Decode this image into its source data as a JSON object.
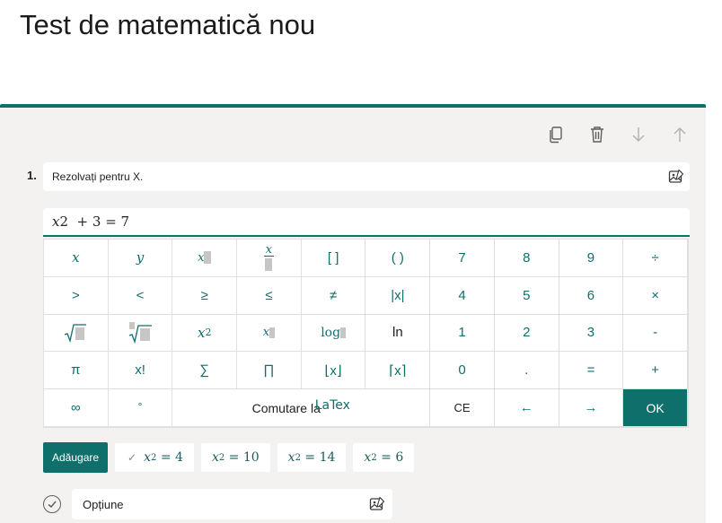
{
  "page": {
    "title": "Test de matematică nou"
  },
  "toolbar": {
    "icons": [
      "copy-icon",
      "trash-icon",
      "arrow-down-icon",
      "arrow-up-icon"
    ]
  },
  "question": {
    "number": "1.",
    "text": "Rezolvați pentru X.",
    "image_icon": "image-edit-icon"
  },
  "math_input": {
    "var": "x",
    "rest": "2  + 3 = 7"
  },
  "keypad": {
    "row1": [
      "x",
      "y",
      "",
      "",
      "[ ]",
      "( )",
      "7",
      "8",
      "9",
      "÷"
    ],
    "row2": [
      ">",
      "<",
      "≥",
      "≤",
      "≠",
      "|x|",
      "4",
      "5",
      "6",
      "×"
    ],
    "row3": [
      "",
      "",
      "x",
      "x",
      "log",
      "ln",
      "1",
      "2",
      "3",
      "-"
    ],
    "row4": [
      "π",
      "x!",
      "∑",
      "∏",
      "⌊x⌋",
      "⌈x⌉",
      "0",
      ".",
      "=",
      "+"
    ],
    "row5": {
      "inf": "∞",
      "deg": "°",
      "toggle_prefix": "Comutare la",
      "toggle_latex": "LaTex",
      "ce": "CE",
      "left": "←",
      "right": "→",
      "ok": "OK"
    },
    "frac_x": "x",
    "pow_sup": "2"
  },
  "answers": {
    "add_label": "Adăugare",
    "chips": [
      {
        "var": "x",
        "sub": "2",
        "rest": " = 4"
      },
      {
        "var": "x",
        "sub": "2",
        "rest": " = 10"
      },
      {
        "var": "x",
        "sub": "2",
        "rest": " = 14"
      },
      {
        "var": "x",
        "sub": "2",
        "rest": " = 6"
      }
    ],
    "check_mark": "✓"
  },
  "option": {
    "label": "Opțiune"
  },
  "colors": {
    "accent": "#0e6f6b",
    "card": "#f3f2f1"
  }
}
